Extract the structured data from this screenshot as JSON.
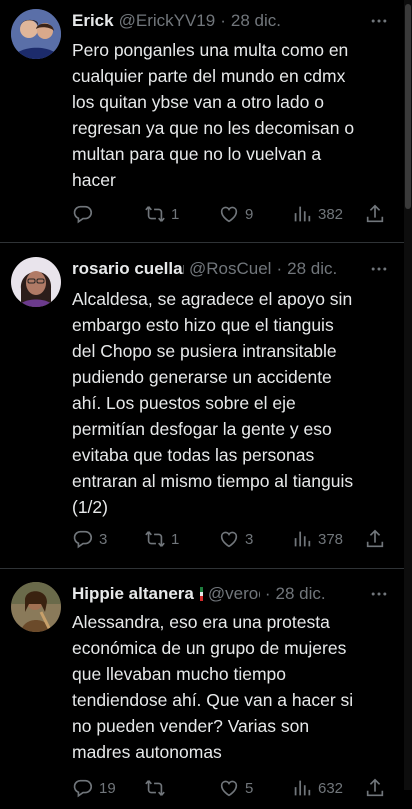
{
  "tweets": [
    {
      "name": "Erick",
      "handle": "@ErickYV19",
      "date": "28 dic.",
      "text": "Pero ponganles una multa como en\ncualquier parte del mundo en cdmx\nlos quitan ybse van a otro lado o\nregresan ya que no les decomisan o\nmultan para que no lo vuelvan a\nhacer",
      "replies": "",
      "retweets": "1",
      "likes": "9",
      "views": "382"
    },
    {
      "name": "rosario cuellar",
      "handle": "@RosCuel",
      "date": "28 dic.",
      "text": "Alcaldesa, se agradece el apoyo sin\nembargo esto hizo que el tianguis\ndel Chopo se pusiera intransitable\npudiendo generarse un accidente\nahí. Los puestos sobre el eje\npermitían desfogar la gente y eso\nevitaba que todas las personas\nentraran al mismo tiempo al tianguis\n(1/2)",
      "replies": "3",
      "retweets": "1",
      "likes": "3",
      "views": "378"
    },
    {
      "name": "Hippie altanera",
      "name_badge_colors": [
        "#1c7c3c",
        "#e7e9ea",
        "#d22b2b"
      ],
      "handle": "@veroc",
      "date": "28 dic.",
      "text": "Alessandra, eso era una protesta\neconómica de un grupo de mujeres\nque llevaban mucho tiempo\ntendiendose ahí. Que van a hacer si\nno pueden vender? Varias son\nmadres autonomas",
      "replies": "19",
      "retweets": "",
      "likes": "5",
      "views": "632"
    }
  ],
  "icons": {
    "reply": "reply-icon",
    "retweet": "retweet-icon",
    "like": "heart-icon",
    "views": "views-icon",
    "share": "share-icon",
    "more": "more-icon"
  },
  "colors": {
    "background": "#000000",
    "text": "#e7e9ea",
    "muted": "#71767b",
    "divider": "#2f3336"
  }
}
